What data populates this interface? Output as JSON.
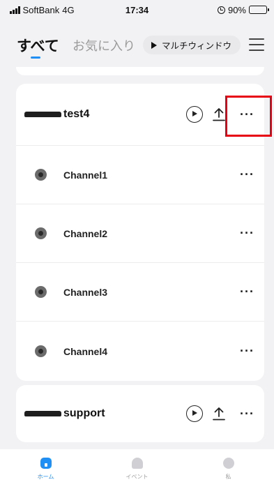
{
  "status_bar": {
    "carrier": "SoftBank",
    "network": "4G",
    "time": "17:34",
    "battery": "90%",
    "battery_level": 0.9
  },
  "header": {
    "tab_all": "すべて",
    "tab_favorites": "お気に入り",
    "multi_window": "マルチウィンドウ",
    "menu_icon": "hamburger-icon"
  },
  "devices": [
    {
      "name": "test4",
      "channels": [
        {
          "name": "Channel1"
        },
        {
          "name": "Channel2"
        },
        {
          "name": "Channel3"
        },
        {
          "name": "Channel4"
        }
      ]
    },
    {
      "name": "support",
      "channels": []
    }
  ],
  "more_symbol": "···",
  "bottom_nav": [
    {
      "label": "ホーム",
      "icon": "home-icon",
      "active": true
    },
    {
      "label": "イベント",
      "icon": "bell-icon",
      "active": false
    },
    {
      "label": "私",
      "icon": "profile-icon",
      "active": false
    }
  ],
  "colors": {
    "accent": "#1f8ff5",
    "highlight": "#e60012",
    "background": "#f2f2f4"
  }
}
